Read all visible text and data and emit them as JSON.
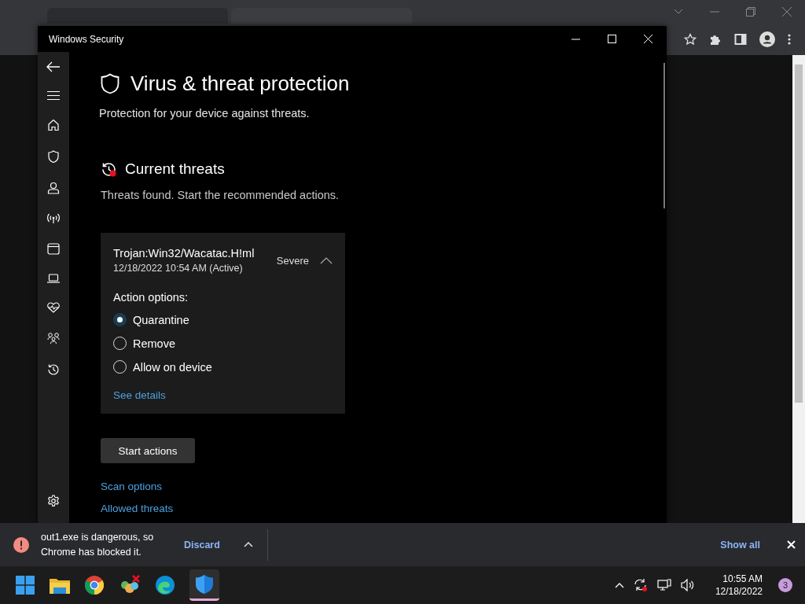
{
  "window": {
    "title": "Windows Security"
  },
  "page": {
    "title": "Virus & threat protection",
    "subtitle": "Protection for your device against threats."
  },
  "section": {
    "title": "Current threats",
    "subtitle": "Threats found. Start the recommended actions."
  },
  "threat": {
    "name": "Trojan:Win32/Wacatac.H!ml",
    "detected": "12/18/2022 10:54 AM (Active)",
    "severity": "Severe",
    "expanded": true,
    "action_label": "Action options:",
    "options": [
      {
        "label": "Quarantine",
        "selected": true
      },
      {
        "label": "Remove",
        "selected": false
      },
      {
        "label": "Allow on device",
        "selected": false
      }
    ],
    "details_link": "See details"
  },
  "primary_button": "Start actions",
  "links": [
    "Scan options",
    "Allowed threats"
  ],
  "download_bar": {
    "message": "out1.exe is dangerous, so Chrome has blocked it.",
    "discard": "Discard",
    "show_all": "Show all"
  },
  "clock": {
    "time": "10:55 AM",
    "date": "12/18/2022"
  },
  "notification_count": "3"
}
